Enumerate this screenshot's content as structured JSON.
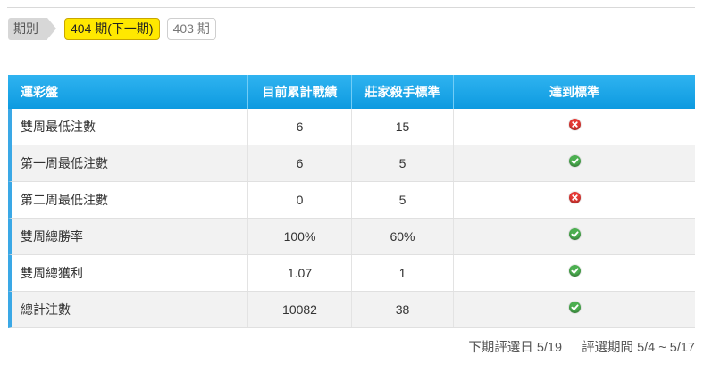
{
  "period": {
    "label": "期別",
    "current": "404 期(下一期)",
    "previous": "403 期"
  },
  "table": {
    "headers": [
      "運彩盤",
      "目前累計戰績",
      "莊家殺手標準",
      "達到標準"
    ],
    "rows": [
      {
        "name": "雙周最低注數",
        "current": "6",
        "standard": "15",
        "met": false
      },
      {
        "name": "第一周最低注數",
        "current": "6",
        "standard": "5",
        "met": true
      },
      {
        "name": "第二周最低注數",
        "current": "0",
        "standard": "5",
        "met": false
      },
      {
        "name": "雙周總勝率",
        "current": "100%",
        "standard": "60%",
        "met": true
      },
      {
        "name": "雙周總獲利",
        "current": "1.07",
        "standard": "1",
        "met": true
      },
      {
        "name": "總計注數",
        "current": "10082",
        "standard": "38",
        "met": true
      }
    ]
  },
  "footer": {
    "next_selection": "下期評選日 5/19",
    "selection_period": "評選期間 5/4 ~ 5/17"
  },
  "colors": {
    "header": "#0d9ae0",
    "current_period": "#ffe800",
    "met": "#4caf50",
    "not_met": "#e53935"
  },
  "icons": {
    "met": "check-circle-icon",
    "not_met": "x-circle-icon"
  }
}
